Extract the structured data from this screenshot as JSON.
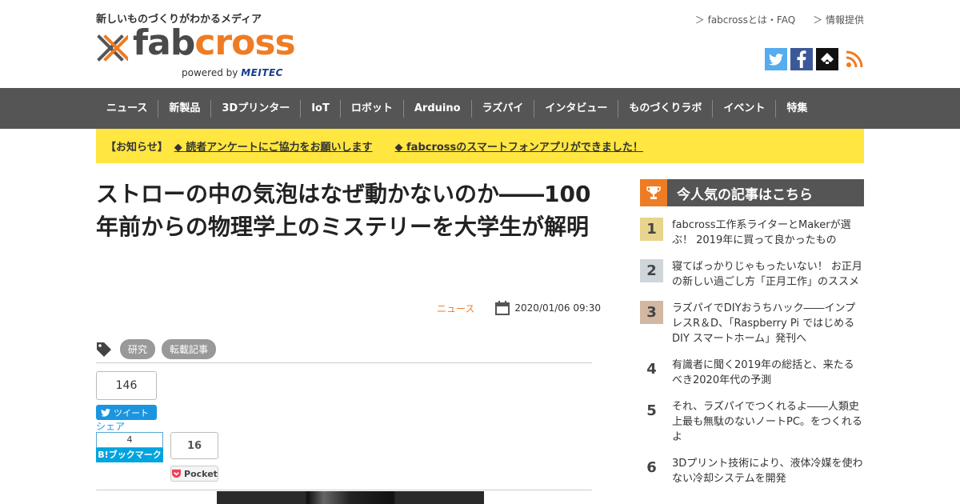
{
  "header": {
    "tagline": "新しいものづくりがわかるメディア",
    "logo": {
      "fab": "fab",
      "cross": "cross",
      "powered": "powered by",
      "meitec": "MEITEC"
    },
    "top_links": [
      "fabcrossとは・FAQ",
      "情報提供"
    ],
    "social": [
      "twitter-icon",
      "facebook-icon",
      "feedly-icon",
      "rss-icon"
    ]
  },
  "nav": {
    "items": [
      "ニュース",
      "新製品",
      "3Dプリンター",
      "IoT",
      "ロボット",
      "Arduino",
      "ラズパイ",
      "インタビュー",
      "ものづくりラボ",
      "イベント",
      "特集"
    ]
  },
  "notice": {
    "label": "【お知らせ】",
    "links": [
      "◆ 読者アンケートにご協力をお願いします",
      "◆ fabcrossのスマートフォンアプリができました！"
    ]
  },
  "article": {
    "title": "ストローの中の気泡はなぜ動かないのか――100年前からの物理学上のミステリーを大学生が解明",
    "category": "ニュース",
    "date": "2020/01/06 09:30",
    "tags": [
      "研究",
      "転載記事"
    ]
  },
  "share": {
    "tweet_count": "146",
    "tweet_label": "ツイート",
    "share_label": "シェア",
    "hatena_count": "4",
    "hatena_label": "B!ブックマーク",
    "pocket_count": "16",
    "pocket_label": "Pocket"
  },
  "sidebar": {
    "ranking_title": "今人気の記事はこちら",
    "ranking": [
      {
        "rank": "1",
        "title": "fabcross工作系ライターとMakerが選ぶ！ 2019年に買って良かったもの"
      },
      {
        "rank": "2",
        "title": "寝てばっかりじゃもったいない！ お正月の新しい過ごし方「正月工作」のススメ"
      },
      {
        "rank": "3",
        "title": "ラズパイでDIYおうちハック――インプレスR＆D、「Raspberry Pi ではじめるDIY スマートホーム」発刊へ"
      },
      {
        "rank": "4",
        "title": "有識者に聞く2019年の総括と、来たるべき2020年代の予測"
      },
      {
        "rank": "5",
        "title": "それ、ラズパイでつくれるよ――人類史上最も無駄のないノートPC。をつくれるよ"
      },
      {
        "rank": "6",
        "title": "3Dプリント技術により、液体冷媒を使わない冷却システムを開発"
      }
    ]
  },
  "colors": {
    "accent": "#ee7c24",
    "nav_bg": "#555555",
    "notice_bg": "#ffe640"
  }
}
